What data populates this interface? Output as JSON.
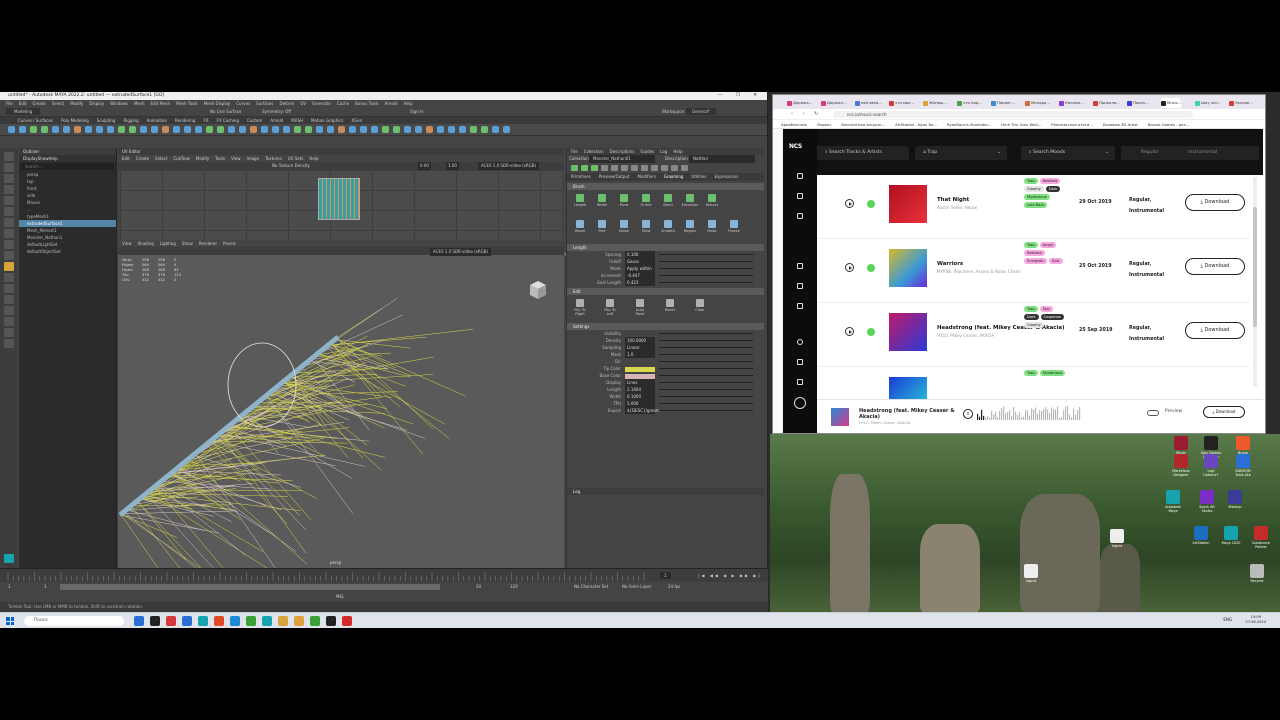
{
  "maya": {
    "title": "untitled* - Autodesk MAYA 2022.2: untitled  ---  extrudedSurface1 [GO]",
    "menu": [
      "File",
      "Edit",
      "Create",
      "Select",
      "Modify",
      "Display",
      "Windows",
      "Mesh",
      "Edit Mesh",
      "Mesh Tools",
      "Mesh Display",
      "Curves",
      "Surfaces",
      "Deform",
      "UV",
      "Generate",
      "Cache",
      "Bonus Tools",
      "Arnold",
      "Help"
    ],
    "workspace_label": "Workspace:",
    "workspace_value": "General*",
    "mode": "Modeling",
    "symmetry": "Symmetry: Off",
    "no_live": "No Live Surface",
    "sign_in": "Sign In",
    "shelf_tabs": [
      "Curves / Surfaces",
      "Poly Modeling",
      "Sculpting",
      "Rigging",
      "Animation",
      "Rendering",
      "FX",
      "FX Caching",
      "Custom",
      "Arnold",
      "MASH",
      "Motion Graphics",
      "XGen"
    ],
    "outliner": {
      "title": "Outliner",
      "menu": [
        "Display",
        "Show",
        "Help"
      ],
      "search": "Search...",
      "rows": [
        "persp",
        "top",
        "front",
        "side",
        "Mouse",
        "...",
        "typeMesh1",
        "extrudedSurface1",
        "Mesh_Mehsxt1",
        "Monster_Nathan1",
        "defaultLightSet",
        "defaultObjectSet"
      ]
    },
    "uv_editor": {
      "title": "UV Editor",
      "menu": [
        "Edit",
        "Create",
        "Select",
        "Cut/Sew",
        "Modify",
        "Tools",
        "View",
        "Image",
        "Textures",
        "UV Sets",
        "Help"
      ],
      "texel": "No Texture Density",
      "val1": "0.00",
      "val2": "1.00",
      "colorspace": "ACES 1.0 SDR-video (sRGB)",
      "status": "(0.0%) UV shells, (0%) overlapping UVs, (0%) reversed UVs",
      "uv": "U: 0.602  V: 0.441"
    },
    "viewport": {
      "menu": [
        "View",
        "Shading",
        "Lighting",
        "Show",
        "Renderer",
        "Panels"
      ],
      "hud": [
        [
          "Verts:",
          "296",
          "296",
          "0"
        ],
        [
          "Edges:",
          "564",
          "564",
          "0"
        ],
        [
          "Faces:",
          "268",
          "268",
          "63"
        ],
        [
          "Tris:",
          "576",
          "576",
          "124"
        ],
        [
          "UVs:",
          "332",
          "332",
          "0"
        ]
      ],
      "camera": "persp",
      "colorspace": "ACES 1.0 SDR-video (sRGB)"
    },
    "xgen": {
      "menu": [
        "File",
        "Collection",
        "Descriptions",
        "Guides",
        "Log",
        "Help"
      ],
      "collection_label": "Collection",
      "collection_value": "Monster_Nathan01",
      "description_label": "Description",
      "description_value": "NatHair",
      "tabs": [
        "Primitives",
        "Preview/Output",
        "Modifiers",
        "Grooming",
        "Utilities",
        "Expressions"
      ],
      "brush_title": "Brush",
      "brush_row1": [
        "Length",
        "Width",
        "Pivot",
        "Orient",
        "Bend",
        "Elevation",
        "Attract"
      ],
      "brush_row2": [
        "Repel",
        "Part",
        "Noise",
        "Twist",
        "Smooth",
        "Region",
        "Mask",
        "Freeze"
      ],
      "length_title": "Length",
      "length_fields": [
        {
          "label": "Spacing",
          "value": "0.100"
        },
        {
          "label": "Falloff",
          "value": "Gauss"
        },
        {
          "label": "Mode",
          "value": "Apply within"
        },
        {
          "label": "Increment",
          "value": "-0.447"
        },
        {
          "label": "Goal Length",
          "value": "0.423"
        }
      ],
      "falloff_opts": [
        "Smooth",
        "Linear",
        "Manifold"
      ],
      "mode_opt": "Apply on all",
      "edit_title": "Edit",
      "edit_tools": [
        "Flip To Right",
        "Flip To Left",
        "Auto Twist",
        "Reset",
        "Clear"
      ],
      "settings_title": "Settings",
      "settings": [
        {
          "label": "Visibility",
          "value": ""
        },
        {
          "label": "Density",
          "value": "100.0000"
        },
        {
          "label": "Sampling",
          "value": "Linear"
        },
        {
          "label": "Mask",
          "value": "1.0"
        },
        {
          "label": "Dir",
          "value": ""
        },
        {
          "label": "Tip Color",
          "value": ""
        },
        {
          "label": "Base Color",
          "value": ""
        },
        {
          "label": "Display",
          "value": "Lines"
        },
        {
          "label": "Length",
          "value": "2.1404"
        },
        {
          "label": "Width",
          "value": "0.1000"
        },
        {
          "label": "TPU",
          "value": "5.000"
        },
        {
          "label": "Export",
          "value": "${DESC}/groom"
        }
      ],
      "sampling_opts": [
        "Nearest",
        "Interpolate"
      ],
      "display_opt": "Cards",
      "split_label": "Split",
      "browse": "Browse...",
      "log_title": "Log"
    },
    "timeline": {
      "start": "1",
      "end": "120",
      "range_start": "1",
      "range_mid": "50",
      "range_end": "120",
      "fps": "24 fps",
      "no_character": "No Character Set",
      "no_anim": "No Anim Layer",
      "mel": "MEL"
    },
    "help_text": "Tumble Tool: Use LMB or MMB to tumble. Shift to constrain rotation."
  },
  "browser": {
    "tabs": [
      "Дорожк...",
      "Дорожн...",
      "extruded...",
      "что мох...",
      "Жанры...",
      "что нор...",
      "Паранг...",
      "Монадо...",
      "Калоны...",
      "Прикола...",
      "Поиск...",
      "Music...",
      "Шоу элп..",
      "Экспре..."
    ],
    "url": "ncs.io/music-search",
    "bookmarks": [
      "Аркаблотчик",
      "Яндекс",
      "Бесплатная загрузк...",
      "ArtStation - Kyan Ra...",
      "RyanRaco's illustratio...",
      "Hinh Thu Gian Wild...",
      "Репопэкспое отоги...",
      "Базовые 3D Artist",
      "Banzai Games - рез..."
    ],
    "search_tracks": "Search Tracks & Artists",
    "genre": "Trap",
    "moods": "Search Moods",
    "filter_regular": "Regular",
    "filter_instrumental": "Instrumental",
    "tracks": [
      {
        "name": "That Night",
        "artist": "Austin Seller, House",
        "tags": [
          [
            "Trap",
            "#7fe07f"
          ],
          [
            "Restless",
            "#f7a6e0"
          ],
          [
            "Gloomy",
            "#e6e6e6"
          ],
          [
            "Dark",
            "#333333"
          ],
          [
            "Mysterious",
            "#7fe07f"
          ],
          [
            "Laid Back",
            "#7fe07f"
          ]
        ],
        "date": "29 Oct 2019",
        "type1": "Regular,",
        "type2": "Instrumental",
        "download": "Download"
      },
      {
        "name": "Warriors",
        "artist": "MYRNE, Repulsive, Axsess & Nolan Chaim",
        "tags": [
          [
            "Trap",
            "#7fe07f"
          ],
          [
            "Angry",
            "#f7a6e0"
          ],
          [
            "Restless",
            "#f7a6e0"
          ],
          [
            "Energetic",
            "#f7a6e0"
          ],
          [
            "Epic",
            "#f7a6e0"
          ]
        ],
        "date": "25 Oct 2019",
        "type1": "Regular,",
        "type2": "Instrumental",
        "download": "Download"
      },
      {
        "name": "Headstrong (feat. Mikey Ceaser & Akacia)",
        "artist": "HYLO, Mikey Ceaser, AKACIA",
        "tags": [
          [
            "Trap",
            "#7fe07f"
          ],
          [
            "Epic",
            "#f7a6e0"
          ],
          [
            "Dark",
            "#333333"
          ],
          [
            "Suspense",
            "#333333"
          ],
          [
            "Gloomy",
            "#e6e6e6"
          ]
        ],
        "date": "25 Sep 2019",
        "type1": "Regular,",
        "type2": "Instrumental",
        "download": "Download"
      },
      {
        "name": "",
        "artist": "",
        "tags": [
          [
            "Trap",
            "#7fe07f"
          ],
          [
            "Mysterious",
            "#7fe07f"
          ]
        ],
        "date": "",
        "type1": "",
        "type2": "",
        "download": ""
      }
    ],
    "player": {
      "title": "Headstrong (feat. Mikey Ceaser &",
      "title2": "Akacia)",
      "artist": "HYLO, Mikey Ceaser, AKACIA",
      "preview": "Preview",
      "download": "Download"
    }
  },
  "desktop": {
    "icons": [
      [
        "Music  Adobe...",
        "#9b1b30"
      ],
      [
        "Epic Games Launcher",
        "#222"
      ],
      [
        "Brave",
        "#f05a2a"
      ],
      [
        "Marvelous Designer",
        "#b3262b"
      ],
      [
        "Logi Options+",
        "#6b46c1"
      ],
      [
        "DAEMON Tools Lite",
        "#2b6fd6"
      ],
      [
        "Autodesk Maya",
        "#16a3b0"
      ],
      [
        "Spark AR Studio",
        "#7a2ec6"
      ],
      [
        "Mazeup",
        "#3b3b9a"
      ],
      [
        "lagcst",
        "#eee"
      ],
      [
        "ArtStation",
        "#1b6ec2"
      ],
      [
        "Maya 2020",
        "#16a3b0"
      ],
      [
        "Substance Painter",
        "#c52b2b"
      ],
      [
        "lagcst",
        "#eee"
      ],
      [
        "Recycle",
        "#bbb"
      ]
    ]
  },
  "taskbar": {
    "search": "Поиск",
    "lang": "ENG",
    "time": "14:09",
    "date": "07.06.2024"
  }
}
